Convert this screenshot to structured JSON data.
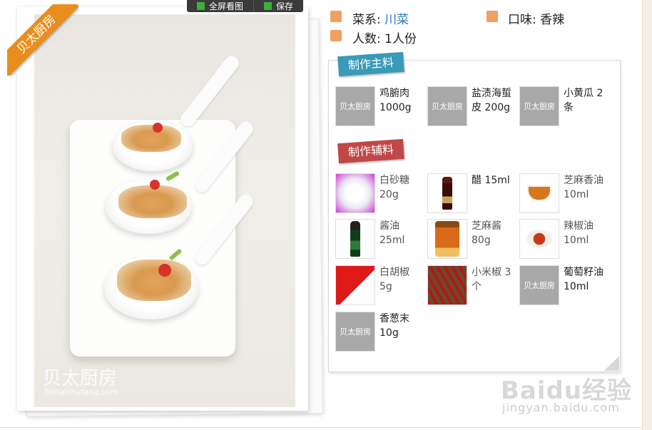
{
  "toolbar": {
    "fullscreen_label": "全屏看图",
    "save_label": "保存"
  },
  "ribbon": {
    "text": "贝太厨房"
  },
  "photo": {
    "watermark": "贝太厨房",
    "watermark_sub": "Beitaichufang.com"
  },
  "info": {
    "cuisine_label": "菜系:",
    "cuisine_value": "川菜",
    "taste_label": "口味:",
    "taste_value": "香辣",
    "servings_label": "人数:",
    "servings_value": "1人份"
  },
  "main_ingredients": {
    "title": "制作主料",
    "items": [
      {
        "name": "鸡腑肉 1000g",
        "thumb": "贝太厨房",
        "icon": "placeholder-image"
      },
      {
        "name": "盐渍海蜇皮 200g",
        "thumb": "贝太厨房",
        "icon": "placeholder-image"
      },
      {
        "name": "小黄瓜 2条",
        "thumb": "贝太厨房",
        "icon": "placeholder-image"
      }
    ]
  },
  "aux_ingredients": {
    "title": "制作辅料",
    "items": [
      {
        "name": "白砂糖 20g",
        "icon": "sugar-photo"
      },
      {
        "name": "醋 15ml",
        "icon": "vinegar-bottle-photo"
      },
      {
        "name": "芝麻香油 10ml",
        "icon": "sesame-oil-photo"
      },
      {
        "name": "酱油 25ml",
        "icon": "soy-sauce-bottle-photo"
      },
      {
        "name": "芝麻酱 80g",
        "icon": "sesame-paste-jar-photo"
      },
      {
        "name": "辣椒油 10ml",
        "icon": "chili-oil-photo"
      },
      {
        "name": "白胡椒 5g",
        "icon": "white-pepper-photo"
      },
      {
        "name": "小米椒 3个",
        "icon": "chili-peppers-photo"
      },
      {
        "name": "葡萄籽油 10ml",
        "thumb": "贝太厨房",
        "icon": "placeholder-image"
      },
      {
        "name": "香葱末 10g",
        "thumb": "贝太厨房",
        "icon": "placeholder-image"
      }
    ]
  },
  "baidu": {
    "logo": "Baidu经验",
    "url": "jingyan.baidu.com"
  }
}
